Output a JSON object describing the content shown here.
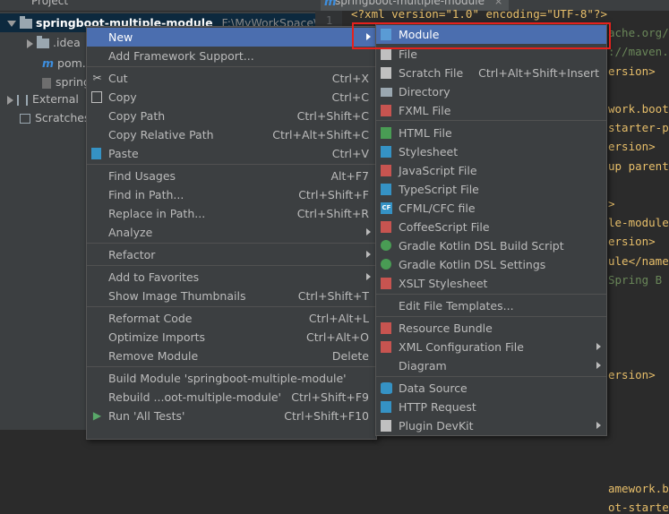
{
  "project_panel": {
    "title": "Project",
    "tree": [
      {
        "label": "springboot-multiple-module",
        "path": "F:\\MyWorkSpace\\IDE"
      },
      {
        "label": ".idea"
      },
      {
        "label": "pom.x"
      },
      {
        "label": "spring"
      },
      {
        "label": "External"
      },
      {
        "label": "Scratches"
      }
    ]
  },
  "editor": {
    "tab_label": "springboot-multiple-module",
    "code_lines": [
      "<?xml version=\"1.0\" encoding=\"UTF-8\"?>",
      "ache.org/PO",
      "://maven.a",
      "ersion>",
      "",
      "work.boot<",
      "starter-pa",
      "ersion>",
      "up parent",
      "",
      ">",
      "le-module<",
      "ersion>",
      "ule</name",
      "Spring B",
      "",
      "",
      "",
      "",
      "ersion>",
      "",
      "",
      "",
      "",
      "",
      "amework.bo",
      "ot-starte"
    ]
  },
  "context_menu": {
    "items": [
      {
        "label": "New",
        "shortcut": "",
        "submenu": true
      },
      {
        "label": "Add Framework Support...",
        "shortcut": ""
      },
      {
        "label": "Cut",
        "shortcut": "Ctrl+X",
        "icon": "scissors-icon"
      },
      {
        "label": "Copy",
        "shortcut": "Ctrl+C",
        "icon": "copy-icon"
      },
      {
        "label": "Copy Path",
        "shortcut": "Ctrl+Shift+C"
      },
      {
        "label": "Copy Relative Path",
        "shortcut": "Ctrl+Alt+Shift+C"
      },
      {
        "label": "Paste",
        "shortcut": "Ctrl+V",
        "icon": "clipboard-icon"
      },
      {
        "label": "Find Usages",
        "shortcut": "Alt+F7"
      },
      {
        "label": "Find in Path...",
        "shortcut": "Ctrl+Shift+F"
      },
      {
        "label": "Replace in Path...",
        "shortcut": "Ctrl+Shift+R"
      },
      {
        "label": "Analyze",
        "shortcut": "",
        "submenu": true
      },
      {
        "label": "Refactor",
        "shortcut": "",
        "submenu": true
      },
      {
        "label": "Add to Favorites",
        "shortcut": "",
        "submenu": true
      },
      {
        "label": "Show Image Thumbnails",
        "shortcut": "Ctrl+Shift+T"
      },
      {
        "label": "Reformat Code",
        "shortcut": "Ctrl+Alt+L"
      },
      {
        "label": "Optimize Imports",
        "shortcut": "Ctrl+Alt+O"
      },
      {
        "label": "Remove Module",
        "shortcut": "Delete"
      },
      {
        "label": "Build Module 'springboot-multiple-module'",
        "shortcut": ""
      },
      {
        "label": "Rebuild ...oot-multiple-module'",
        "shortcut": "Ctrl+Shift+F9"
      },
      {
        "label": "Run 'All Tests'",
        "shortcut": "Ctrl+Shift+F10",
        "icon": "run-icon"
      }
    ]
  },
  "new_submenu": {
    "items": [
      {
        "label": "Module",
        "shortcut": "",
        "icon": "module-icon",
        "color": "#5a9bd5"
      },
      {
        "label": "File",
        "shortcut": "",
        "icon": "file-icon",
        "color": "#c0c0c0"
      },
      {
        "label": "Scratch File",
        "shortcut": "Ctrl+Alt+Shift+Insert",
        "icon": "scratch-file-icon",
        "color": "#c0c0c0"
      },
      {
        "label": "Directory",
        "shortcut": "",
        "icon": "folder-icon",
        "color": "#9aa7b0"
      },
      {
        "label": "FXML File",
        "shortcut": "",
        "icon": "fxml-icon",
        "color": "#c75450"
      },
      {
        "label": "HTML File",
        "shortcut": "",
        "icon": "html-icon",
        "color": "#499c54"
      },
      {
        "label": "Stylesheet",
        "shortcut": "",
        "icon": "css-icon",
        "color": "#3592c4"
      },
      {
        "label": "JavaScript File",
        "shortcut": "",
        "icon": "js-icon",
        "color": "#c75450"
      },
      {
        "label": "TypeScript File",
        "shortcut": "",
        "icon": "ts-icon",
        "color": "#3592c4"
      },
      {
        "label": "CFML/CFC file",
        "shortcut": "",
        "icon": "cfml-icon",
        "color": "#3592c4"
      },
      {
        "label": "CoffeeScript File",
        "shortcut": "",
        "icon": "coffeescript-icon",
        "color": "#c75450"
      },
      {
        "label": "Gradle Kotlin DSL Build Script",
        "shortcut": "",
        "icon": "gradle-icon",
        "color": "#499c54"
      },
      {
        "label": "Gradle Kotlin DSL Settings",
        "shortcut": "",
        "icon": "gradle-icon",
        "color": "#499c54"
      },
      {
        "label": "XSLT Stylesheet",
        "shortcut": "",
        "icon": "xslt-icon",
        "color": "#c75450"
      },
      {
        "label": "Edit File Templates...",
        "shortcut": ""
      },
      {
        "label": "Resource Bundle",
        "shortcut": "",
        "icon": "resource-bundle-icon",
        "color": "#c75450"
      },
      {
        "label": "XML Configuration File",
        "shortcut": "",
        "icon": "xml-icon",
        "color": "#c75450",
        "submenu": true
      },
      {
        "label": "Diagram",
        "shortcut": "",
        "submenu": true
      },
      {
        "label": "Data Source",
        "shortcut": "",
        "icon": "database-icon",
        "color": "#3592c4"
      },
      {
        "label": "HTTP Request",
        "shortcut": "",
        "icon": "http-request-icon",
        "color": "#3592c4"
      },
      {
        "label": "Plugin DevKit",
        "shortcut": "",
        "icon": "plugin-icon",
        "color": "#c0c0c0",
        "submenu": true
      }
    ]
  }
}
